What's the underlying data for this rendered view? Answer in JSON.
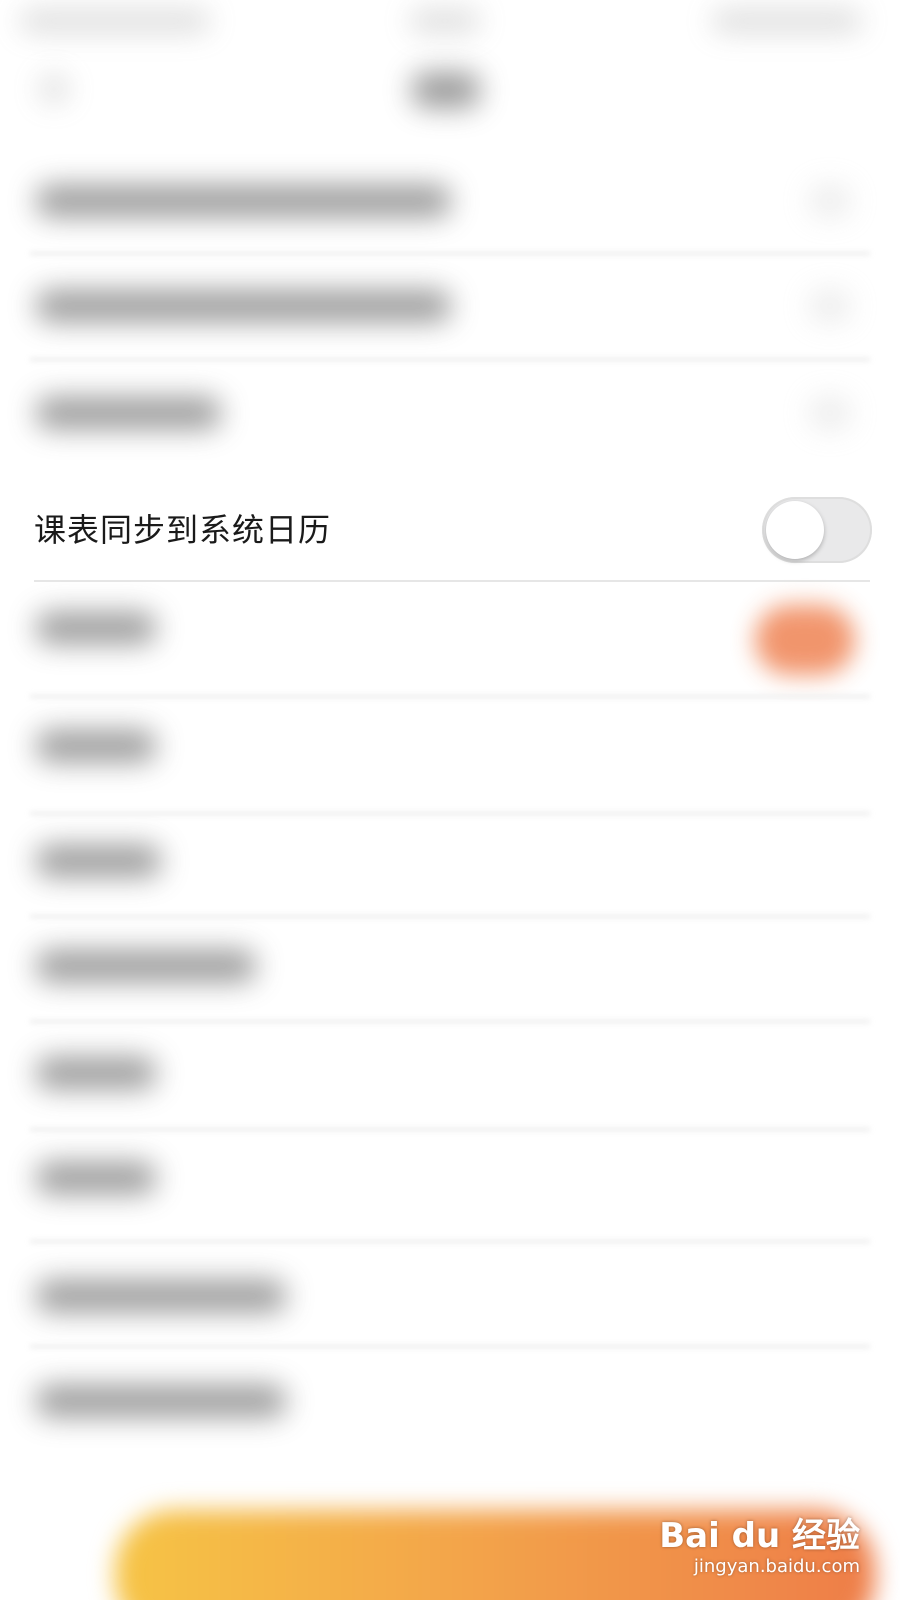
{
  "settings_row": {
    "label": "课表同步到系统日历",
    "toggle_state": "off"
  },
  "colors": {
    "accent_orange": "#f08a5d",
    "button_gradient_start": "#f6c445",
    "button_gradient_end": "#ee7d48"
  },
  "watermark": {
    "logo": "Bai du 经验",
    "url": "jingyan.baidu.com"
  }
}
